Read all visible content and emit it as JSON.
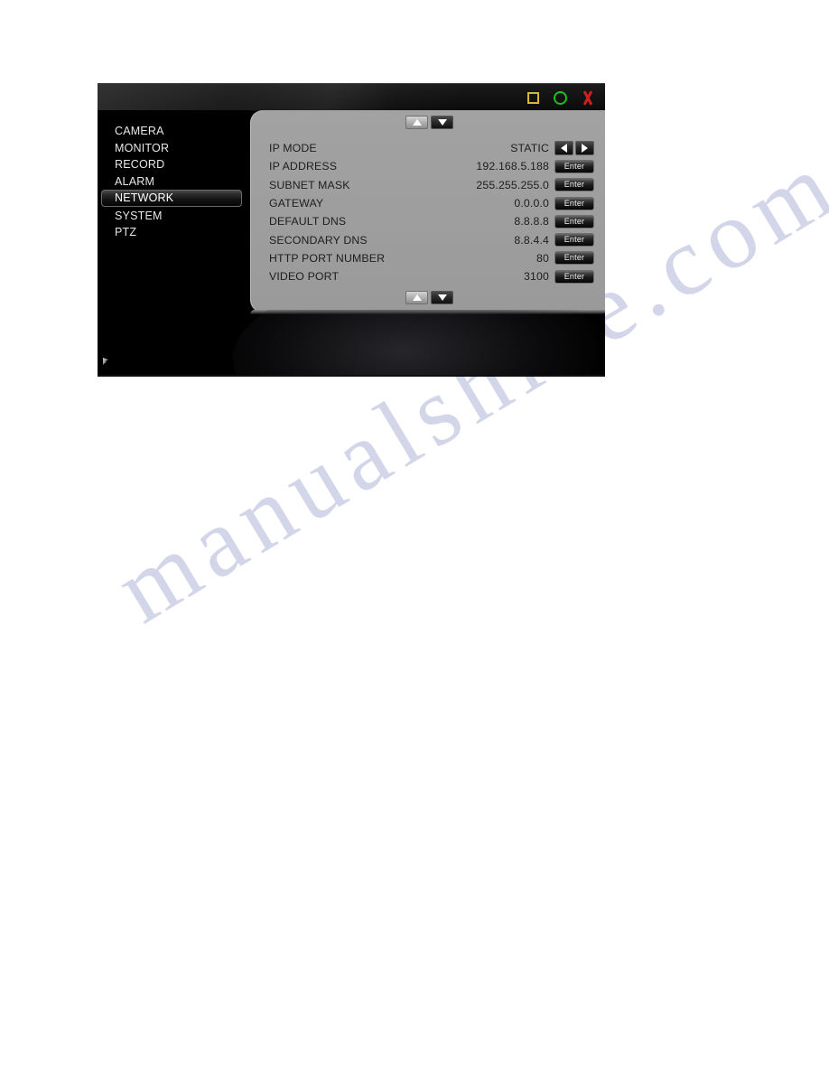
{
  "window": {
    "controls": [
      {
        "name": "restore-icon",
        "icon": "square-outline",
        "color": "#d8b63c",
        "label": "Restore"
      },
      {
        "name": "minimize-icon",
        "icon": "circle-outline",
        "color": "#19c319",
        "label": "Minimize"
      },
      {
        "name": "close-icon",
        "icon": "x-mark",
        "color": "#cc2020",
        "label": "Close"
      }
    ]
  },
  "sidebar": {
    "items": [
      {
        "label": "CAMERA",
        "selected": false
      },
      {
        "label": "MONITOR",
        "selected": false
      },
      {
        "label": "RECORD",
        "selected": false
      },
      {
        "label": "ALARM",
        "selected": false
      },
      {
        "label": "NETWORK",
        "selected": true
      },
      {
        "label": "SYSTEM",
        "selected": false
      },
      {
        "label": "PTZ",
        "selected": false
      }
    ]
  },
  "scroll": {
    "up_icon": "triangle-up-icon",
    "down_icon": "triangle-down-icon"
  },
  "settings": {
    "rows": [
      {
        "label": "IP MODE",
        "value": "STATIC",
        "control": "arrows"
      },
      {
        "label": "IP ADDRESS",
        "value": "192.168.5.188",
        "control": "enter",
        "button_label": "Enter"
      },
      {
        "label": "SUBNET MASK",
        "value": "255.255.255.0",
        "control": "enter",
        "button_label": "Enter"
      },
      {
        "label": "GATEWAY",
        "value": "0.0.0.0",
        "control": "enter",
        "button_label": "Enter"
      },
      {
        "label": "DEFAULT DNS",
        "value": "8.8.8.8",
        "control": "enter",
        "button_label": "Enter"
      },
      {
        "label": "SECONDARY DNS",
        "value": "8.8.4.4",
        "control": "enter",
        "button_label": "Enter"
      },
      {
        "label": "HTTP PORT NUMBER",
        "value": "80",
        "control": "enter",
        "button_label": "Enter"
      },
      {
        "label": "VIDEO PORT",
        "value": "3100",
        "control": "enter",
        "button_label": "Enter"
      }
    ]
  },
  "watermark": {
    "text": "manualshive.com"
  },
  "colors": {
    "panel_gray": "#9e9e9e",
    "window_black": "#000000",
    "text_dark": "#1d1d1d",
    "text_light": "#e8e8e8",
    "accent_yellow": "#d8b63c",
    "accent_green": "#19c319",
    "accent_red": "#cc2020"
  }
}
